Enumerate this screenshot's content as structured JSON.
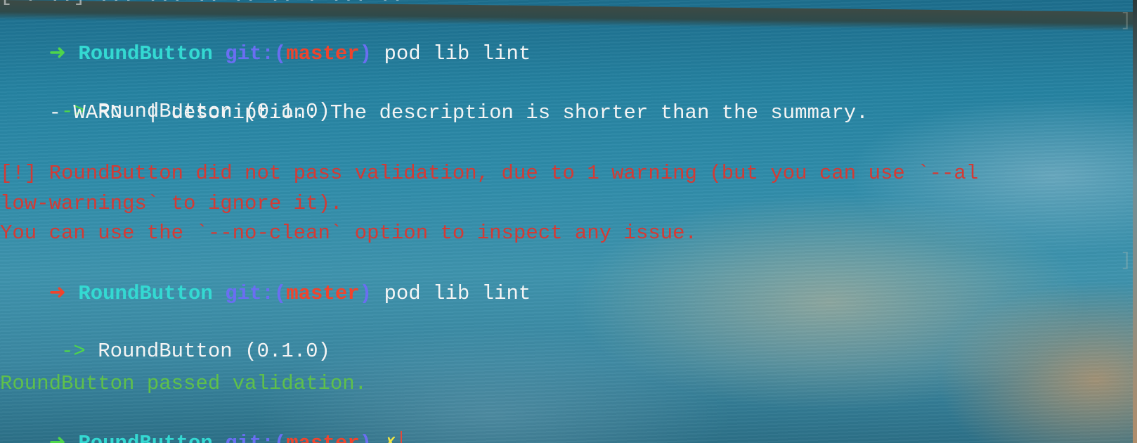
{
  "terminal": {
    "top_partial": "[ . ..] ... ... .. .. .. . ... ..",
    "prompt1": {
      "arrow": "➜",
      "dir": "RoundButton",
      "git": "git:",
      "paren_open": "(",
      "branch": "master",
      "paren_close": ")",
      "command": " pod lib lint"
    },
    "lint1": {
      "arrow": " ->",
      "pod": " RoundButton (0.1.0)",
      "warn": "    - WARN  | description: The description is shorter than the summary."
    },
    "error": {
      "line1": "[!] RoundButton did not pass validation, due to 1 warning (but you can use `--al",
      "line2": "low-warnings` to ignore it).",
      "line3": "You can use the `--no-clean` option to inspect any issue."
    },
    "prompt2": {
      "arrow": "➜",
      "dir": "RoundButton",
      "git": "git:",
      "paren_open": "(",
      "branch": "master",
      "paren_close": ")",
      "command": " pod lib lint"
    },
    "lint2": {
      "arrow": " ->",
      "pod": " RoundButton (0.1.0)"
    },
    "success": "RoundButton passed validation.",
    "prompt3": {
      "arrow": "➜",
      "dir": "RoundButton",
      "git": "git:",
      "paren_open": "(",
      "branch": "master",
      "paren_close": ")",
      "dirty": "✗"
    }
  },
  "colors": {
    "prompt_ok_arrow": "#4fd64a",
    "prompt_err_arrow": "#f0442c",
    "dir": "#34d9d2",
    "git": "#6a6ef2",
    "branch": "#f0442c",
    "error_text": "#d43a34",
    "success_text": "#5fc04a",
    "dirty_marker": "#f2e642"
  }
}
